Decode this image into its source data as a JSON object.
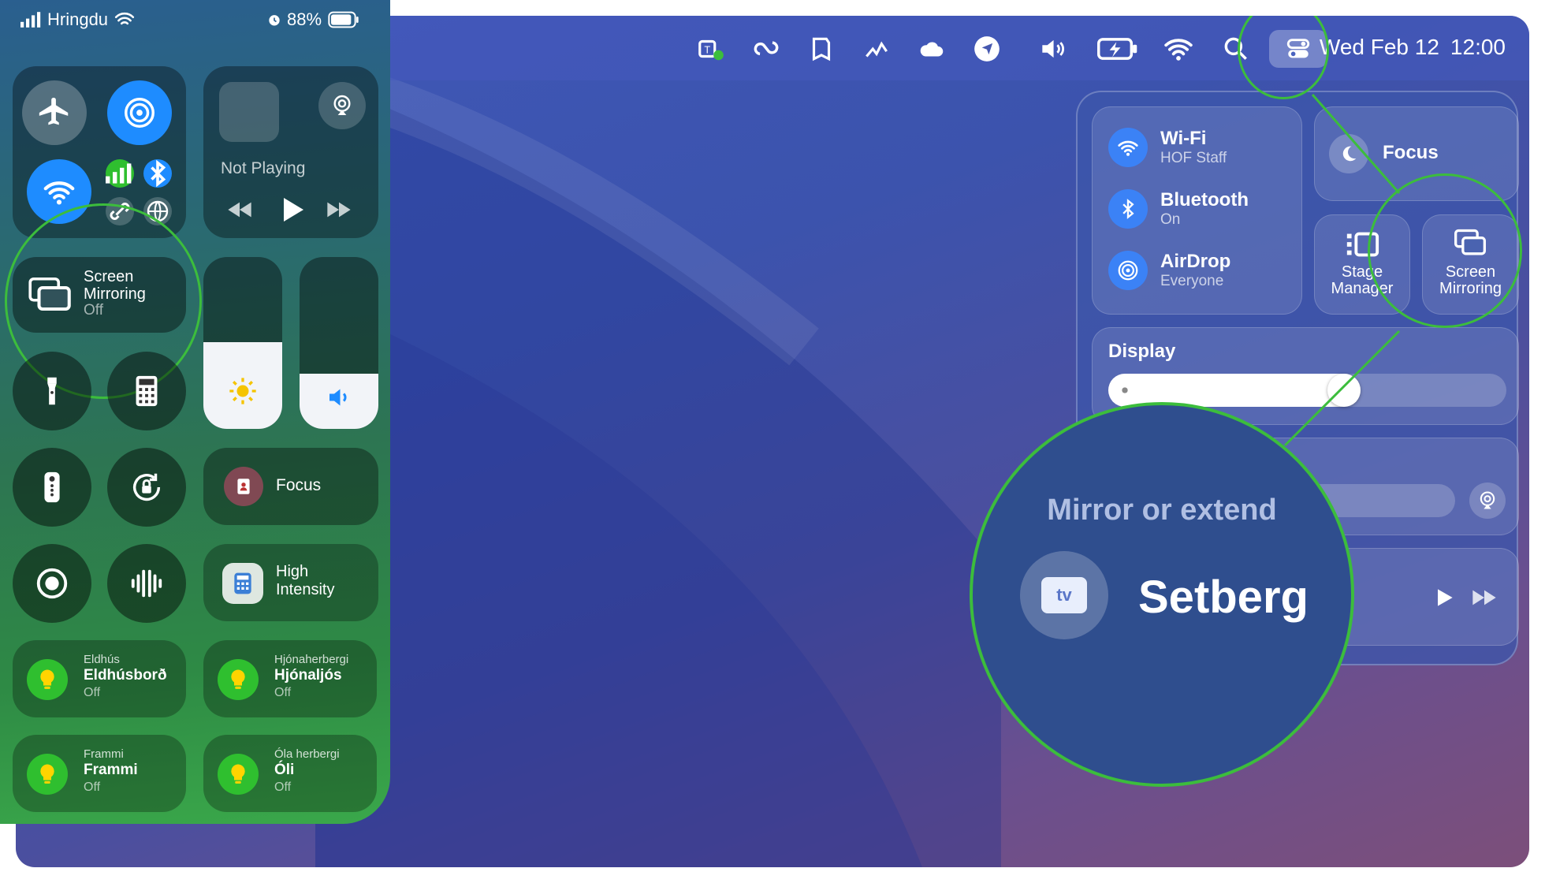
{
  "phone": {
    "status": {
      "carrier": "Hringdu",
      "battery": "88%"
    },
    "media": {
      "label": "Not Playing"
    },
    "screen_mirroring": {
      "title_line1": "Screen",
      "title_line2": "Mirroring",
      "state": "Off"
    },
    "focus": {
      "label": "Focus"
    },
    "high_intensity": {
      "line1": "High",
      "line2": "Intensity"
    },
    "home": [
      {
        "room": "Eldhús",
        "name": "Eldhúsborð",
        "state": "Off"
      },
      {
        "room": "Hjónaherbergi",
        "name": "Hjónaljós",
        "state": "Off"
      },
      {
        "room": "Frammi",
        "name": "Frammi",
        "state": "Off"
      },
      {
        "room": "Óla herbergi",
        "name": "Óli",
        "state": "Off"
      }
    ]
  },
  "mac": {
    "menubar": {
      "date": "Wed Feb 12",
      "time": "12:00"
    },
    "control_center": {
      "wifi": {
        "title": "Wi-Fi",
        "sub": "HOF Staff"
      },
      "bluetooth": {
        "title": "Bluetooth",
        "sub": "On"
      },
      "airdrop": {
        "title": "AirDrop",
        "sub": "Everyone"
      },
      "focus": {
        "label": "Focus"
      },
      "stage_manager": {
        "line1": "Stage",
        "line2": "Manager"
      },
      "screen_mirroring": {
        "line1": "Screen",
        "line2": "Mirroring"
      },
      "display": {
        "label": "Display",
        "brightness": 0.6
      }
    },
    "zoom": {
      "heading": "Mirror or extend",
      "device": "Setberg",
      "device_badge": "tv"
    }
  },
  "colors": {
    "accent_blue": "#3b82f6",
    "highlight_green": "#3cbd3c",
    "bulb_green": "#2fbf2f"
  }
}
